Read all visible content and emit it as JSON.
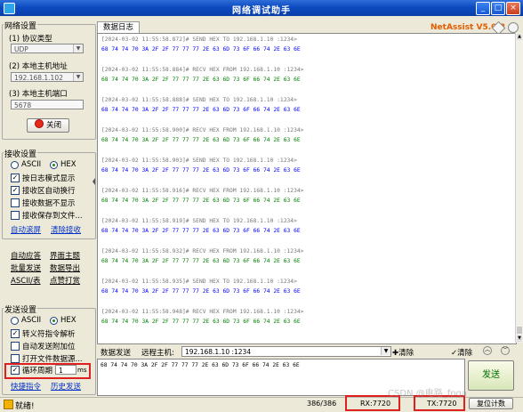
{
  "window": {
    "title": "网络调试助手",
    "brand": "NetAssist V5.0.2",
    "min": "_",
    "max": "□",
    "close": "×"
  },
  "network": {
    "group_title": "网络设置",
    "protocol_label": "(1) 协议类型",
    "protocol_value": "UDP",
    "host_label": "(2) 本地主机地址",
    "host_value": "192.168.1.102",
    "port_label": "(3) 本地主机端口",
    "port_value": "5678",
    "close_button": "关闭"
  },
  "receive": {
    "group_title": "接收设置",
    "ascii": "ASCII",
    "hex": "HEX",
    "options": [
      "按日志模式显示",
      "接收区自动换行",
      "接收数据不显示",
      "接收保存到文件..."
    ],
    "auto_clear": "自动滚屏",
    "clear_receive": "清除接收"
  },
  "misc": {
    "auto_reply": "自动应答",
    "theme": "界面主题",
    "batch_send": "批量发送",
    "export": "数据导出",
    "ascii_table": "ASCII/表",
    "tools": "点赞打赏"
  },
  "send": {
    "group_title": "发送设置",
    "ascii": "ASCII",
    "hex": "HEX",
    "options": [
      "转义符指令解析",
      "自动发送附加位",
      "打开文件数据源..."
    ],
    "loop_label": "循环周期",
    "loop_value": "1",
    "loop_unit": "ms",
    "quick_cmd": "快捷指令",
    "history": "历史发送"
  },
  "log": {
    "tab": "数据日志",
    "payload": "68 74 74 70 3A 2F 2F 77 77 77 2E 63 6D 73 6F 66 74 2E 63 6E",
    "entries": [
      {
        "header": "[2024-03-02 11:55:58.872]# SEND HEX TO 192.168.1.10 :1234>",
        "dir": "send"
      },
      {
        "header": "[2024-03-02 11:55:58.884]# RECV HEX FROM 192.168.1.10 :1234>",
        "dir": "recv"
      },
      {
        "header": "[2024-03-02 11:55:58.888]# SEND HEX TO 192.168.1.10 :1234>",
        "dir": "send"
      },
      {
        "header": "[2024-03-02 11:55:58.900]# RECV HEX FROM 192.168.1.10 :1234>",
        "dir": "recv"
      },
      {
        "header": "[2024-03-02 11:55:58.903]# SEND HEX TO 192.168.1.10 :1234>",
        "dir": "send"
      },
      {
        "header": "[2024-03-02 11:55:58.916]# RECV HEX FROM 192.168.1.10 :1234>",
        "dir": "recv"
      },
      {
        "header": "[2024-03-02 11:55:58.919]# SEND HEX TO 192.168.1.10 :1234>",
        "dir": "send"
      },
      {
        "header": "[2024-03-02 11:55:58.932]# RECV HEX FROM 192.168.1.10 :1234>",
        "dir": "recv"
      },
      {
        "header": "[2024-03-02 11:55:58.935]# SEND HEX TO 192.168.1.10 :1234>",
        "dir": "send"
      },
      {
        "header": "[2024-03-02 11:55:58.948]# RECV HEX FROM 192.168.1.10 :1234>",
        "dir": "recv"
      }
    ]
  },
  "sendbar": {
    "tab": "数据发送",
    "remote_label": "远程主机:",
    "remote_value": "192.168.1.10 :1234",
    "clear1": "清除",
    "clear2": "清除",
    "send_text": "68 74 74 70 3A 2F 2F 77 77 77 2E 63 6D 73 6F 66 74 2E 63 6E",
    "send_button": "发送"
  },
  "status": {
    "ready": "就绪!",
    "count": "386/386",
    "rx": "RX:7720",
    "tx": "TX:7720",
    "reset": "复位计数",
    "watermark": "CSDN @电路_fpga"
  }
}
